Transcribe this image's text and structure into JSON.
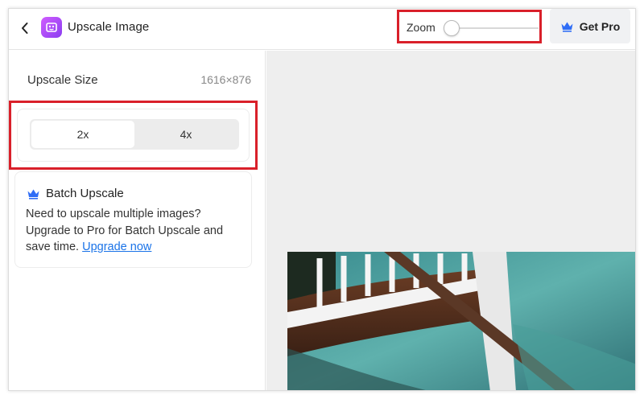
{
  "header": {
    "title": "Upscale Image",
    "zoom_label": "Zoom",
    "zoom_value": 0,
    "get_pro_label": "Get Pro"
  },
  "sidebar": {
    "upscale_size_label": "Upscale Size",
    "upscale_size_value": "1616×876",
    "scale_options": [
      "2x",
      "4x"
    ],
    "selected_scale": "2x",
    "batch": {
      "title": "Batch Upscale",
      "text": "Need to upscale multiple images? Upgrade to Pro for Batch Upscale and save time.",
      "link": "Upgrade now"
    }
  },
  "colors": {
    "highlight_border": "#d9202a",
    "link": "#1a73e8",
    "accent_icon": "#2f6df6",
    "app_icon": "#b04cf5"
  },
  "icons": {
    "back": "chevron-left-icon",
    "app": "upscale-app-icon",
    "pro": "crown-icon"
  }
}
